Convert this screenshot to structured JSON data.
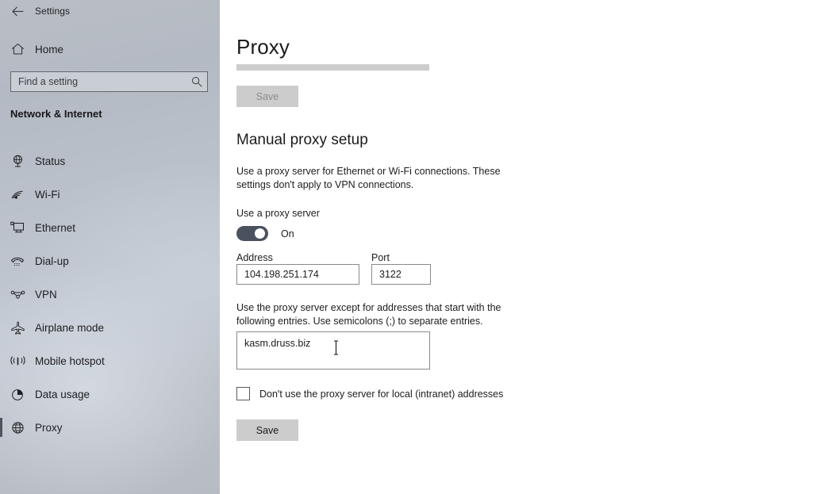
{
  "window": {
    "title": "Settings",
    "back_icon": "back-arrow-icon",
    "controls": {
      "minimize": "minimize-icon",
      "maximize": "maximize-icon",
      "close": "close-icon"
    }
  },
  "sidebar": {
    "home_label": "Home",
    "home_icon": "home-icon",
    "search": {
      "placeholder": "Find a setting",
      "value": "",
      "icon": "search-icon"
    },
    "category": "Network & Internet",
    "items": [
      {
        "label": "Status",
        "icon": "status-globe-icon",
        "selected": false
      },
      {
        "label": "Wi-Fi",
        "icon": "wifi-icon",
        "selected": false
      },
      {
        "label": "Ethernet",
        "icon": "ethernet-icon",
        "selected": false
      },
      {
        "label": "Dial-up",
        "icon": "dialup-phone-icon",
        "selected": false
      },
      {
        "label": "VPN",
        "icon": "vpn-icon",
        "selected": false
      },
      {
        "label": "Airplane mode",
        "icon": "airplane-icon",
        "selected": false
      },
      {
        "label": "Mobile hotspot",
        "icon": "hotspot-icon",
        "selected": false
      },
      {
        "label": "Data usage",
        "icon": "data-usage-pie-icon",
        "selected": false
      },
      {
        "label": "Proxy",
        "icon": "proxy-globe-icon",
        "selected": true
      }
    ]
  },
  "main": {
    "page_title": "Proxy",
    "save_top_label": "Save",
    "save_top_disabled": true,
    "manual_heading": "Manual proxy setup",
    "manual_description": "Use a proxy server for Ethernet or Wi-Fi connections. These settings don't apply to VPN connections.",
    "use_proxy_label": "Use a proxy server",
    "toggle_state": "On",
    "toggle_on": true,
    "address_label": "Address",
    "address_value": "104.198.251.174",
    "port_label": "Port",
    "port_value": "3122",
    "exceptions_description": "Use the proxy server except for addresses that start with the following entries. Use semicolons (;) to separate entries.",
    "exceptions_value": "kasm.druss.biz",
    "bypass_local_label": "Don't use the proxy server for local (intranet) addresses",
    "bypass_local_checked": false,
    "save_bottom_label": "Save"
  },
  "colors": {
    "accent_selected": "#4e5561",
    "toggle_on": "#4a5260",
    "sidebar_base": "#bcc2cb",
    "button": "#cccccc",
    "skeleton": "#cdcdcd"
  }
}
